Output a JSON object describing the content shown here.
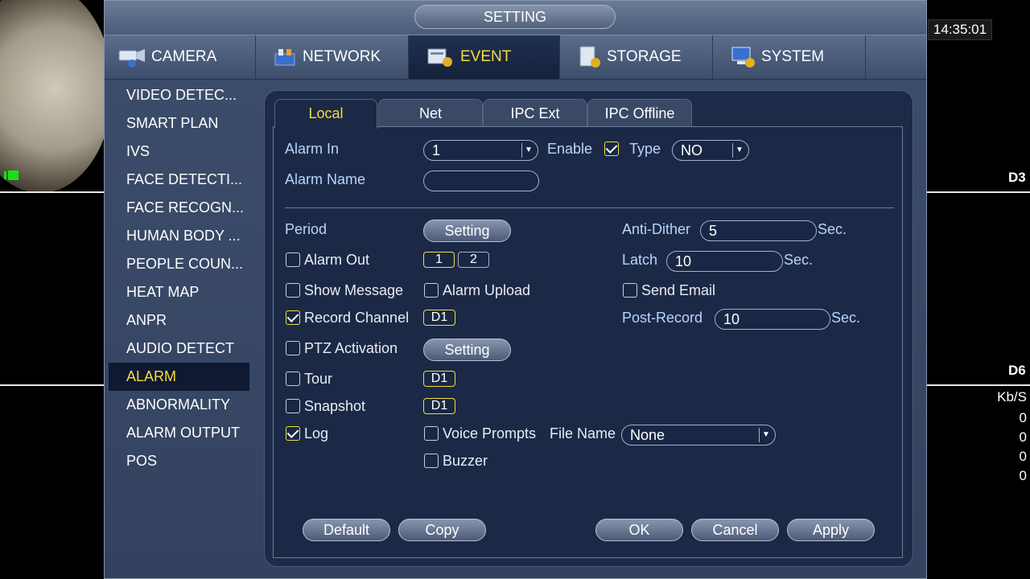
{
  "clock": "14:35:01",
  "side_labels": {
    "d3": "D3",
    "d6": "D6"
  },
  "bitrate": {
    "unit": "Kb/S",
    "values": [
      "0",
      "0",
      "0",
      "0"
    ]
  },
  "window": {
    "title": "SETTING"
  },
  "topnav": [
    {
      "label": "CAMERA",
      "icon": "camera-icon"
    },
    {
      "label": "NETWORK",
      "icon": "network-icon"
    },
    {
      "label": "EVENT",
      "icon": "event-icon",
      "active": true
    },
    {
      "label": "STORAGE",
      "icon": "storage-icon"
    },
    {
      "label": "SYSTEM",
      "icon": "system-icon"
    }
  ],
  "leftnav": [
    "VIDEO DETEC...",
    "SMART PLAN",
    "IVS",
    "FACE DETECTI...",
    "FACE RECOGN...",
    "HUMAN BODY ...",
    "PEOPLE COUN...",
    "HEAT MAP",
    "ANPR",
    "AUDIO DETECT",
    "ALARM",
    "ABNORMALITY",
    "ALARM OUTPUT",
    "POS"
  ],
  "leftnav_active": "ALARM",
  "subtabs": [
    "Local",
    "Net",
    "IPC Ext",
    "IPC Offline"
  ],
  "form": {
    "alarm_in_label": "Alarm In",
    "alarm_in_value": "1",
    "enable_label": "Enable",
    "enable_checked": true,
    "type_label": "Type",
    "type_value": "NO",
    "alarm_name_label": "Alarm Name",
    "alarm_name_value": "",
    "period_label": "Period",
    "setting_label": "Setting",
    "anti_dither_label": "Anti-Dither",
    "anti_dither_value": "5",
    "sec": "Sec.",
    "alarm_out_label": "Alarm Out",
    "alarm_out_channels": [
      "1",
      "2"
    ],
    "latch_label": "Latch",
    "latch_value": "10",
    "show_message_label": "Show Message",
    "alarm_upload_label": "Alarm Upload",
    "send_email_label": "Send Email",
    "record_channel_label": "Record Channel",
    "record_channel_checked": true,
    "record_channel_chip": "D1",
    "post_record_label": "Post-Record",
    "post_record_value": "10",
    "ptz_label": "PTZ Activation",
    "tour_label": "Tour",
    "tour_chip": "D1",
    "snapshot_label": "Snapshot",
    "snapshot_chip": "D1",
    "log_label": "Log",
    "log_checked": true,
    "voice_prompts_label": "Voice Prompts",
    "file_name_label": "File Name",
    "file_name_value": "None",
    "buzzer_label": "Buzzer"
  },
  "buttons": {
    "default": "Default",
    "copy": "Copy",
    "ok": "OK",
    "cancel": "Cancel",
    "apply": "Apply"
  },
  "colors": {
    "accent": "#f5dc3c",
    "label_blue": "#b8d4ff",
    "panel": "#1e2b48"
  }
}
